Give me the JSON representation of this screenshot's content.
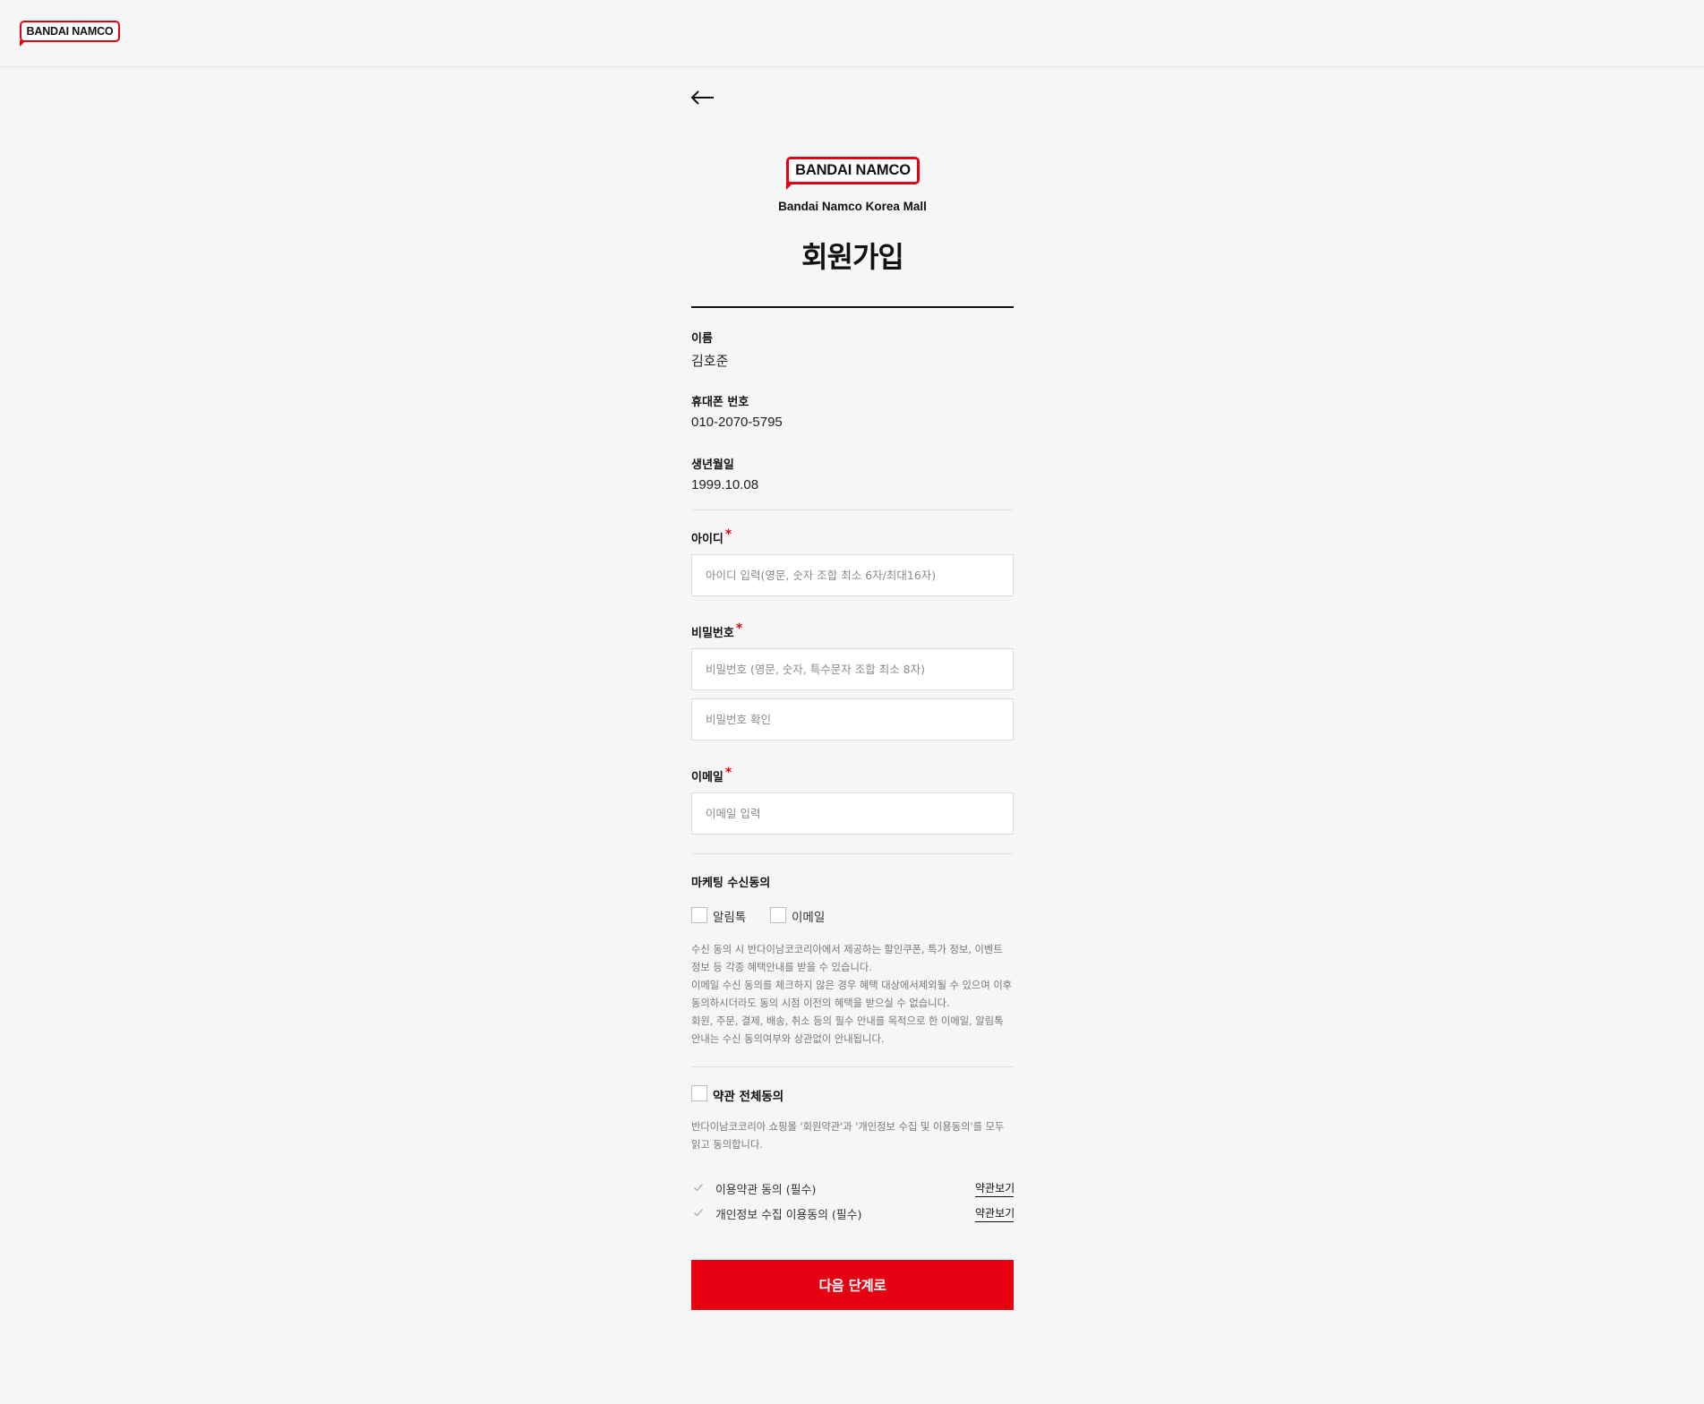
{
  "header": {
    "logo_text": "BANDAI NAMCO"
  },
  "page": {
    "brand_logo_text": "BANDAI NAMCO",
    "subtitle": "Bandai Namco Korea Mall",
    "title": "회원가입",
    "back_icon": "arrow-left-icon"
  },
  "profile": {
    "name_label": "이름",
    "name_value": "김호준",
    "phone_label": "휴대폰 번호",
    "phone_value": "010-2070-5795",
    "birth_label": "생년월일",
    "birth_value": "1999.10.08"
  },
  "form": {
    "required_mark": "*",
    "id_label": "아이디",
    "id_value": "",
    "id_placeholder": "아이디 입력(영문, 숫자 조합 최소 6자/최대16자)",
    "password_label": "비밀번호",
    "password_value": "",
    "password_placeholder": "비밀번호 (영문, 숫자, 특수문자 조합 최소 8자)",
    "password_confirm_value": "",
    "password_confirm_placeholder": "비밀번호 확인",
    "email_label": "이메일",
    "email_value": "",
    "email_placeholder": "이메일 입력"
  },
  "marketing": {
    "label": "마케팅 수신동의",
    "options": [
      {
        "label": "알림톡",
        "checked": false
      },
      {
        "label": "이메일",
        "checked": false
      }
    ],
    "notice_lines": [
      "수신 동의 시 반다이남코코리아에서 제공하는 할인쿠폰, 특가 정보, 이벤트",
      "정보 등 각종 혜택안내를 받을 수 있습니다.",
      "이메일 수신 동의를 체크하지 않은 경우 혜택 대상에서제외될 수 있으며 이후",
      "동의하시더라도 동의 시점 이전의 혜택을 받으실 수 없습니다.",
      "회원, 주문, 결제, 배송, 취소 등의 필수 안내를 목적으로 한 이메일, 알림톡",
      "안내는 수신 동의여부와 상관없이 안내됩니다."
    ]
  },
  "terms": {
    "all_label": "약관 전체동의",
    "all_checked": false,
    "notice_lines": [
      "반다이남코코리아 쇼핑몰 '회원약관'과 '개인정보 수집 및 이용동의'를 모두",
      "읽고 동의합니다."
    ],
    "items": [
      {
        "label": "이용약관 동의 (필수)",
        "link": "약관보기"
      },
      {
        "label": "개인정보 수집 이용동의 (필수)",
        "link": "약관보기"
      }
    ]
  },
  "submit_label": "다음 단계로",
  "colors": {
    "accent": "#e60012",
    "background": "#f6f6f6"
  }
}
